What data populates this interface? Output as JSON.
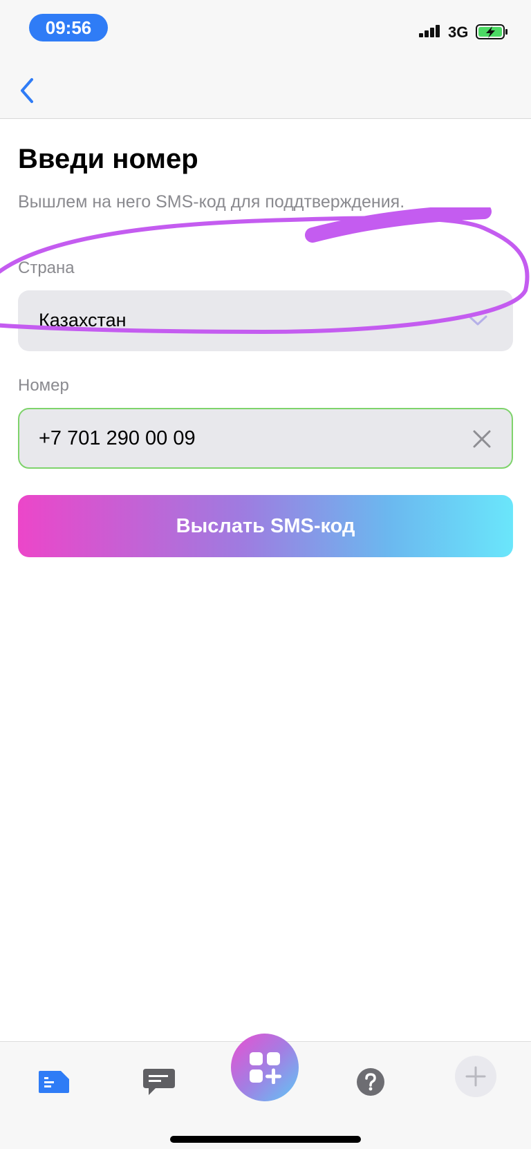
{
  "status_bar": {
    "time": "09:56",
    "network": "3G",
    "signal_icon": "signal-bars-icon",
    "battery_icon": "battery-charging-icon"
  },
  "nav": {
    "back_icon": "chevron-left-icon"
  },
  "page": {
    "title": "Введи номер",
    "subtitle": "Вышлем на него SMS-код для поддтверждения."
  },
  "form": {
    "country_label": "Страна",
    "country_value": "Казахстан",
    "number_label": "Номер",
    "phone_value": "+7 701 290 00 09",
    "submit_label": "Выслать SMS-код"
  },
  "tab_bar": {
    "items": [
      "feed-icon",
      "chat-icon",
      "apps-add-icon",
      "help-icon",
      "plus-icon"
    ]
  },
  "colors": {
    "accent": "#2f7cf6",
    "field_bg": "#e8e8ec",
    "valid_border": "#7ed36b",
    "annotation": "#c45cf0",
    "gradient_start": "#ec46c9",
    "gradient_end": "#6ae6fb"
  }
}
